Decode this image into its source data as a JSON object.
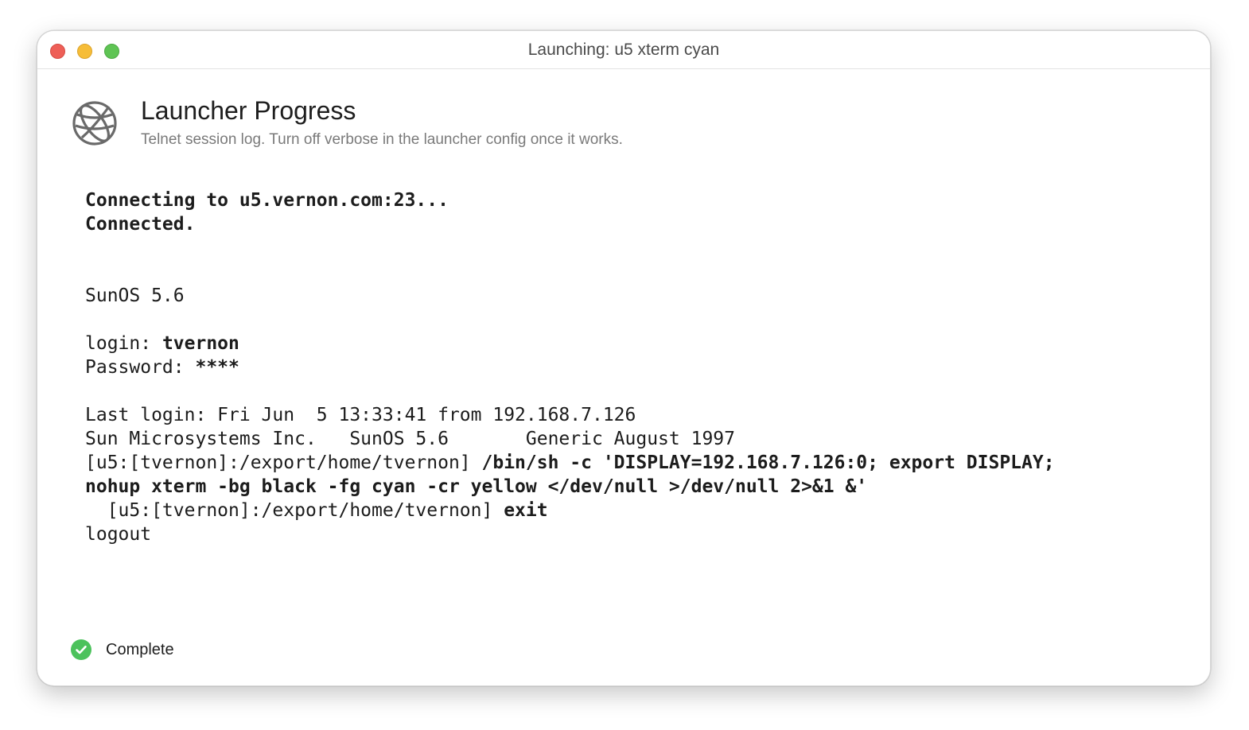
{
  "window": {
    "title": "Launching: u5 xterm cyan"
  },
  "header": {
    "icon": "globe-icon",
    "title": "Launcher Progress",
    "subtitle": "Telnet session log. Turn off verbose in the launcher config once it works."
  },
  "log": {
    "lines": [
      {
        "normal": "",
        "bold": "Connecting to u5.vernon.com:23..."
      },
      {
        "normal": "",
        "bold": "Connected."
      },
      {
        "normal": "",
        "bold": ""
      },
      {
        "normal": "",
        "bold": ""
      },
      {
        "normal": "SunOS 5.6",
        "bold": ""
      },
      {
        "normal": "",
        "bold": ""
      },
      {
        "normal": "login: ",
        "bold": "tvernon"
      },
      {
        "normal": "Password: ",
        "bold": "****"
      },
      {
        "normal": "",
        "bold": ""
      },
      {
        "normal": "Last login: Fri Jun  5 13:33:41 from 192.168.7.126",
        "bold": ""
      },
      {
        "normal": "Sun Microsystems Inc.   SunOS 5.6       Generic August 1997",
        "bold": ""
      },
      {
        "normal": "[u5:[tvernon]:/export/home/tvernon] ",
        "bold": "/bin/sh -c 'DISPLAY=192.168.7.126:0; export DISPLAY;"
      },
      {
        "normal": "",
        "bold": "nohup xterm -bg black -fg cyan -cr yellow </dev/null >/dev/null 2>&1 &'"
      },
      {
        "normal": "  [u5:[tvernon]:/export/home/tvernon] ",
        "bold": "exit"
      },
      {
        "normal": "logout",
        "bold": ""
      }
    ]
  },
  "status": {
    "icon": "checkmark-circle-icon",
    "color": "#4cc25c",
    "text": "Complete"
  }
}
